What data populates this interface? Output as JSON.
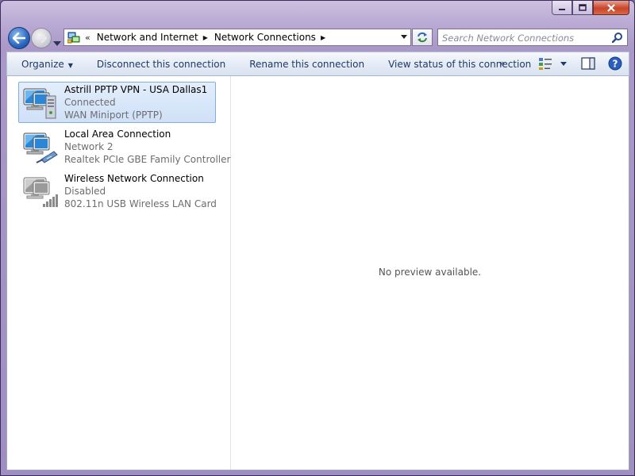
{
  "window": {
    "caption_buttons": [
      "minimize",
      "maximize",
      "close"
    ]
  },
  "address": {
    "chevron": "«",
    "breadcrumbs": [
      "Network and Internet",
      "Network Connections"
    ]
  },
  "search": {
    "placeholder": "Search Network Connections"
  },
  "toolbar": {
    "organize_label": "Organize",
    "disconnect_label": "Disconnect this connection",
    "rename_label": "Rename this connection",
    "status_label": "View status of this connection",
    "more_label": "»"
  },
  "connections": [
    {
      "name": "Astrill PPTP VPN - USA Dallas1",
      "status": "Connected",
      "device": "WAN Miniport (PPTP)",
      "selected": true,
      "icon": "vpn-connection-icon"
    },
    {
      "name": "Local Area Connection",
      "status": "Network  2",
      "device": "Realtek PCIe GBE Family Controller",
      "selected": false,
      "icon": "ethernet-connection-icon"
    },
    {
      "name": "Wireless Network Connection",
      "status": "Disabled",
      "device": "802.11n USB Wireless LAN Card",
      "selected": false,
      "icon": "wireless-connection-icon"
    }
  ],
  "preview": {
    "message": "No preview available."
  },
  "colors": {
    "accent": "#1e3a66",
    "selection": "#cfe0f7",
    "frame": "#a998c8"
  }
}
